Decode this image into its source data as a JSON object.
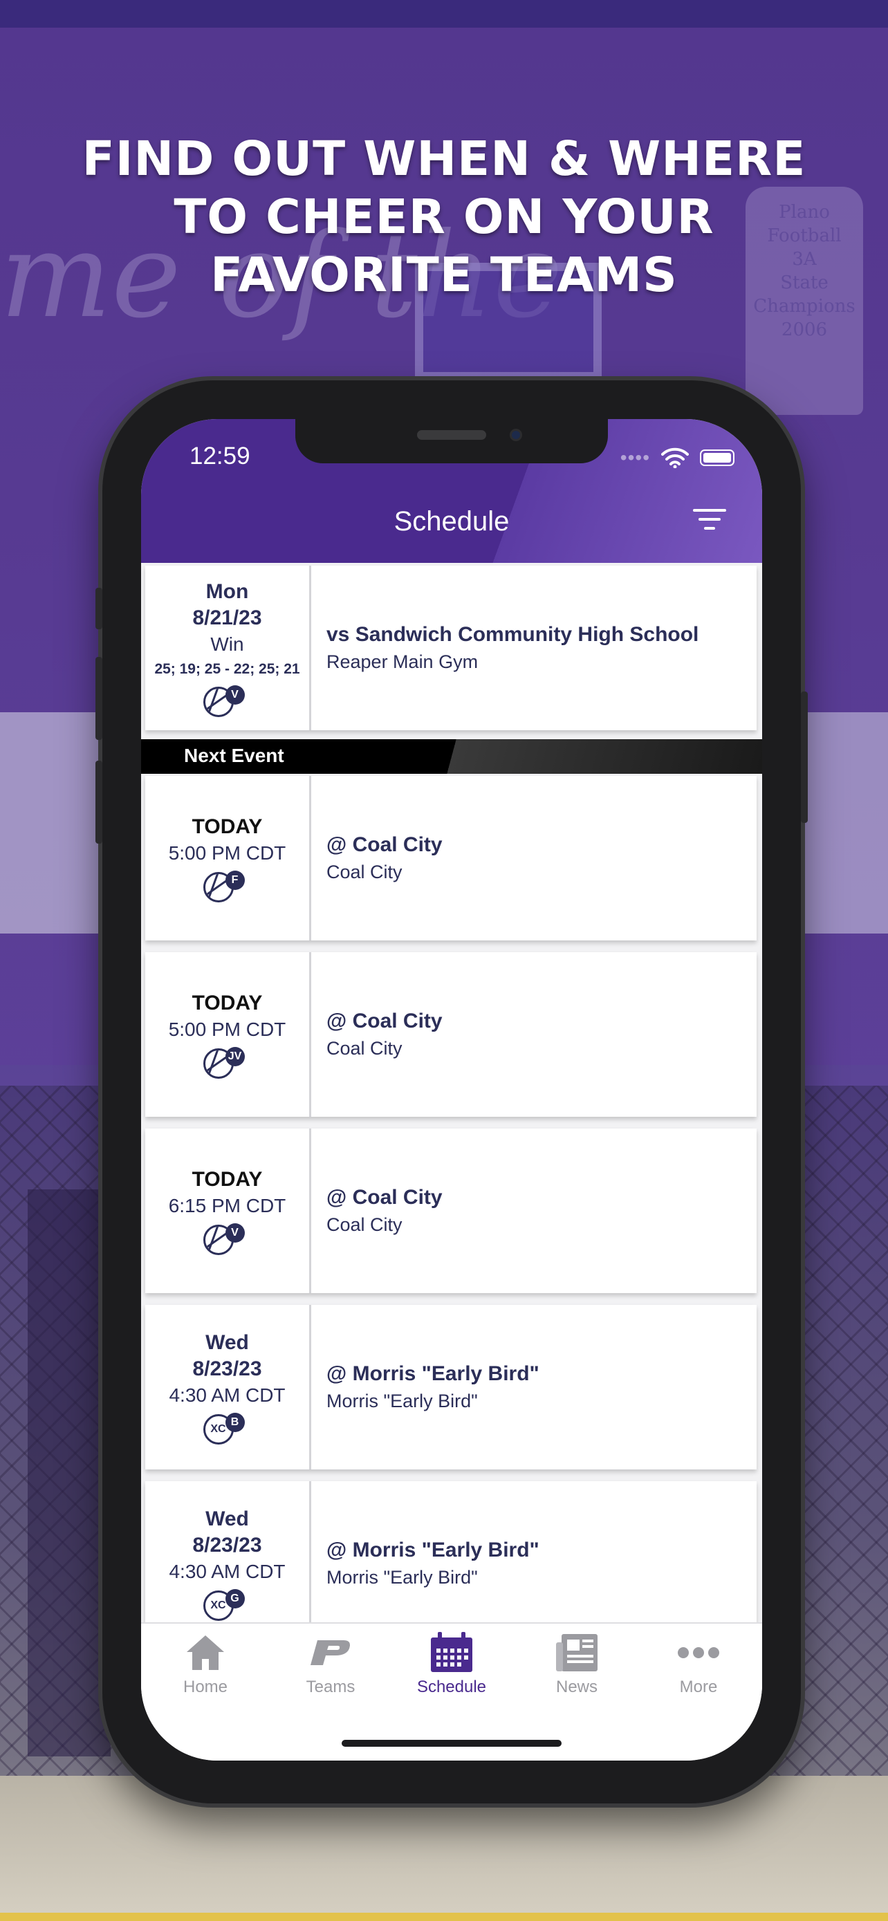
{
  "headline": {
    "line1": "FIND OUT WHEN & WHERE",
    "line2": "TO CHEER ON YOUR",
    "line3": "FAVORITE TEAMS"
  },
  "background": {
    "script_text": "me of the",
    "plaque_lines": [
      "Plano",
      "Football",
      "3A",
      "State",
      "Champions",
      "2006"
    ]
  },
  "status_bar": {
    "time": "12:59"
  },
  "header": {
    "title": "Schedule",
    "filter_icon": "filter-lines-icon"
  },
  "next_event_label": "Next Event",
  "events": [
    {
      "day": "Mon",
      "date": "8/21/23",
      "result": "Win",
      "score": "25; 19; 25 - 22; 25; 21",
      "sport_icon": "volleyball-icon",
      "level": "V",
      "title": "vs Sandwich Community High School",
      "location": "Reaper Main Gym"
    },
    {
      "day": "TODAY",
      "time": "5:00 PM CDT",
      "sport_icon": "volleyball-icon",
      "level": "F",
      "title": "@ Coal City",
      "location": "Coal City"
    },
    {
      "day": "TODAY",
      "time": "5:00 PM CDT",
      "sport_icon": "volleyball-icon",
      "level": "JV",
      "title": "@ Coal City",
      "location": "Coal City"
    },
    {
      "day": "TODAY",
      "time": "6:15 PM CDT",
      "sport_icon": "volleyball-icon",
      "level": "V",
      "title": "@ Coal City",
      "location": "Coal City"
    },
    {
      "day": "Wed",
      "date": "8/23/23",
      "time": "4:30 AM CDT",
      "sport_icon": "cross-country-icon",
      "sport_text": "XC",
      "level": "B",
      "title": "@ Morris \"Early Bird\"",
      "location": "Morris \"Early Bird\""
    },
    {
      "day": "Wed",
      "date": "8/23/23",
      "time": "4:30 AM CDT",
      "sport_icon": "cross-country-icon",
      "sport_text": "XC",
      "level": "G",
      "title": "@ Morris \"Early Bird\"",
      "location": "Morris \"Early Bird\""
    }
  ],
  "tabs": [
    {
      "label": "Home",
      "icon": "home-icon",
      "active": false
    },
    {
      "label": "Teams",
      "icon": "p-logo-icon",
      "active": false
    },
    {
      "label": "Schedule",
      "icon": "calendar-icon",
      "active": true
    },
    {
      "label": "News",
      "icon": "newspaper-icon",
      "active": false
    },
    {
      "label": "More",
      "icon": "more-dots-icon",
      "active": false
    }
  ],
  "colors": {
    "brand_purple": "#4a2a8e",
    "navy_text": "#2b2e58",
    "tab_inactive": "#9b9ba0"
  }
}
